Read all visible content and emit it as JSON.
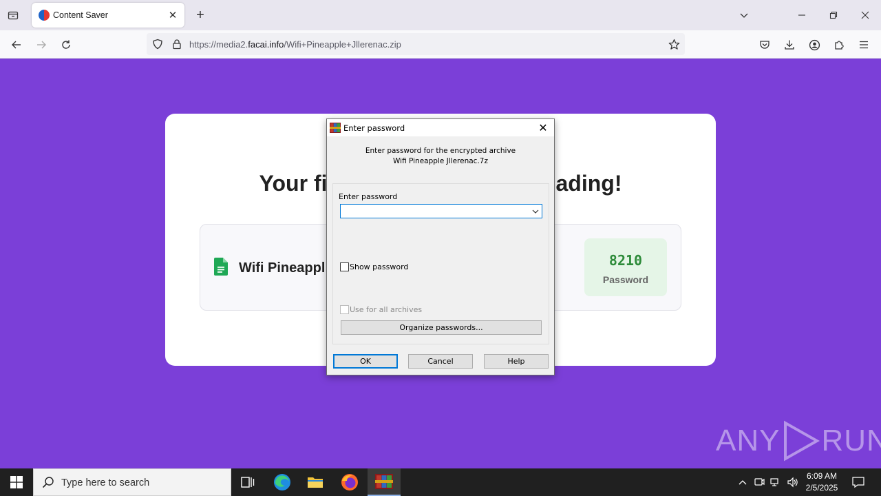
{
  "browser": {
    "tab_title": "Content Saver",
    "url_prefix": "https://media2.",
    "url_domain": "facai.info",
    "url_path": "/Wifi+Pineapple+Jllerenac.zip"
  },
  "page": {
    "headline_left": "Your fi",
    "headline_right": "ading!",
    "file_name": "Wifi Pineappl",
    "password_value": "8210",
    "password_label": "Password",
    "accent_color": "#7b3fd8"
  },
  "dialog": {
    "title": "Enter password",
    "message_line1": "Enter password for the encrypted archive",
    "message_line2": "Wifi Pineapple Jllerenac.7z",
    "field_label": "Enter password",
    "field_value": "",
    "show_password_label": "Show password",
    "use_all_label": "Use for all archives",
    "organize_label": "Organize passwords...",
    "ok_label": "OK",
    "cancel_label": "Cancel",
    "help_label": "Help"
  },
  "watermark": {
    "text_left": "ANY",
    "text_right": "RUN"
  },
  "taskbar": {
    "search_placeholder": "Type here to search",
    "time": "6:09 AM",
    "date": "2/5/2025"
  }
}
